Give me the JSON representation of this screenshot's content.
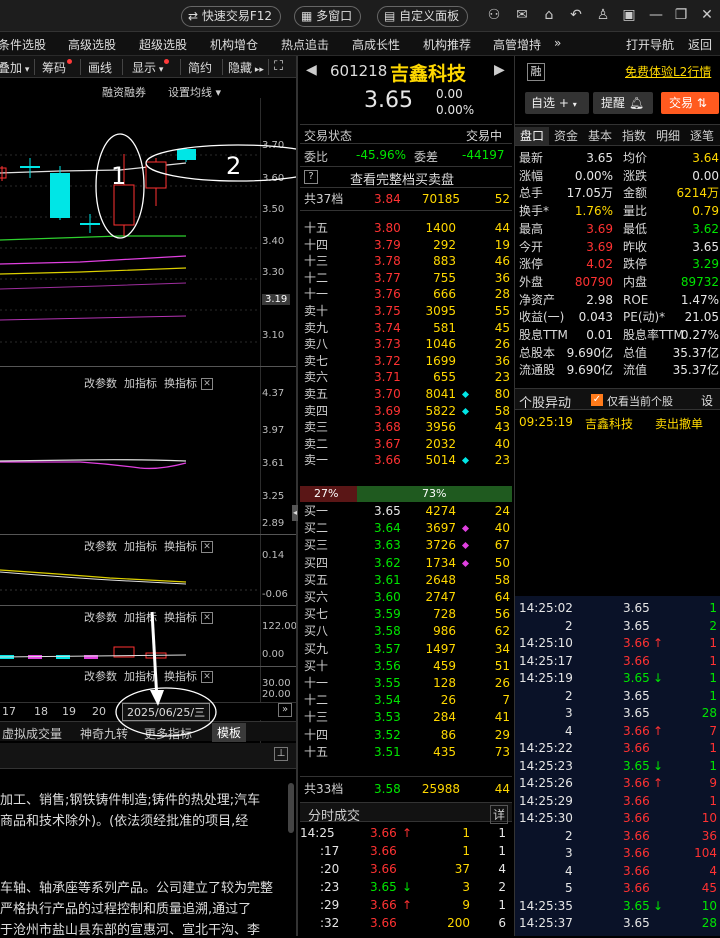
{
  "titlebar": {
    "quick_trade": "快速交易F12",
    "multi_window": "多窗口",
    "custom_panel": "自定义面板"
  },
  "menu": [
    "条件选股",
    "高级选股",
    "超级选股",
    "机构增仓",
    "热点追击",
    "高成长性",
    "机构推荐",
    "高管增持"
  ],
  "menu_more": "»",
  "menu_right": [
    "打开导航",
    "返回"
  ],
  "toolbar": [
    "叠加",
    "筹码",
    "画线",
    "显示",
    "简约",
    "隐藏"
  ],
  "chart": {
    "sub_label_left": "融资融券",
    "sub_label_right": "设置均线",
    "main_axis": [
      "3.70",
      "3.60",
      "3.50",
      "3.40",
      "3.30",
      "3.19",
      "3.10"
    ],
    "macd_axis": [
      "4.37",
      "3.97",
      "3.61",
      "3.25",
      "2.89"
    ],
    "ind2_axis": [
      "0.14",
      "-0.06"
    ],
    "ind3_axis": [
      "122.00",
      "0.00"
    ],
    "ind4_axis": [
      "30.00",
      "20.00"
    ],
    "panel_buttons": [
      "改参数",
      "加指标",
      "换指标"
    ],
    "xticks": [
      "17",
      "18",
      "19",
      "20"
    ],
    "date_box": "2025/06/25/三",
    "bottom_tabs": [
      "虚拟成交量",
      "神奇九转",
      "更多指标",
      "模板"
    ]
  },
  "annotations": [
    "1",
    "2"
  ],
  "company_text": [
    "加工、销售;钢铁铸件制造;铸件的热处理;汽车",
    "商品和技术除外)。(依法须经批准的项目,经",
    "车轴、轴承座等系列产品。公司建立了较为完整",
    "严格执行产品的过程控制和质量追溯,通过了",
    "于沧州市盐山县东部的宣惠河、宣北干沟、李"
  ],
  "stock": {
    "code": "601218",
    "name": "吉鑫科技",
    "price": "3.65",
    "change": "0.00",
    "pct": "0.00%",
    "tag": "融",
    "l2_link": "免费体验L2行情",
    "btn_watch": "自选",
    "btn_alert": "提醒",
    "btn_trade": "交易"
  },
  "orderbook": {
    "status_label": "交易状态",
    "status_value": "交易中",
    "weibi_label": "委比",
    "weibi": "-45.96%",
    "weicha_label": "委差",
    "weicha": "-44197",
    "full_link": "查看完整档买卖盘",
    "q": "?",
    "sell_total": {
      "label": "共37档",
      "price": "3.84",
      "vol": "70185",
      "n": "52"
    },
    "sells": [
      [
        "十五",
        "3.80",
        "1400",
        "44",
        ""
      ],
      [
        "十四",
        "3.79",
        "292",
        "19",
        ""
      ],
      [
        "十三",
        "3.78",
        "883",
        "46",
        ""
      ],
      [
        "十二",
        "3.77",
        "755",
        "36",
        ""
      ],
      [
        "十一",
        "3.76",
        "666",
        "28",
        ""
      ],
      [
        "卖十",
        "3.75",
        "3095",
        "55",
        ""
      ],
      [
        "卖九",
        "3.74",
        "581",
        "45",
        ""
      ],
      [
        "卖八",
        "3.73",
        "1046",
        "26",
        ""
      ],
      [
        "卖七",
        "3.72",
        "1699",
        "36",
        ""
      ],
      [
        "卖六",
        "3.71",
        "655",
        "23",
        ""
      ],
      [
        "卖五",
        "3.70",
        "8041",
        "80",
        "c"
      ],
      [
        "卖四",
        "3.69",
        "5822",
        "58",
        "c"
      ],
      [
        "卖三",
        "3.68",
        "3956",
        "43",
        ""
      ],
      [
        "卖二",
        "3.67",
        "2032",
        "40",
        ""
      ],
      [
        "卖一",
        "3.66",
        "5014",
        "23",
        "c"
      ]
    ],
    "ratio_left": "27%",
    "ratio_right": "73%",
    "ratio_frac": 0.27,
    "buys": [
      [
        "买一",
        "3.65",
        "4274",
        "24",
        "g"
      ],
      [
        "买二",
        "3.64",
        "3697",
        "40",
        "m"
      ],
      [
        "买三",
        "3.63",
        "3726",
        "67",
        "m"
      ],
      [
        "买四",
        "3.62",
        "1734",
        "50",
        "m"
      ],
      [
        "买五",
        "3.61",
        "2648",
        "58",
        "g"
      ],
      [
        "买六",
        "3.60",
        "2747",
        "64",
        "g"
      ],
      [
        "买七",
        "3.59",
        "728",
        "56",
        "g"
      ],
      [
        "买八",
        "3.58",
        "986",
        "62",
        "g"
      ],
      [
        "买九",
        "3.57",
        "1497",
        "34",
        "g"
      ],
      [
        "买十",
        "3.56",
        "459",
        "51",
        "g"
      ],
      [
        "十一",
        "3.55",
        "128",
        "26",
        "g"
      ],
      [
        "十二",
        "3.54",
        "26",
        "7",
        "g"
      ],
      [
        "十三",
        "3.53",
        "284",
        "41",
        "g"
      ],
      [
        "十四",
        "3.52",
        "86",
        "29",
        "g"
      ],
      [
        "十五",
        "3.51",
        "435",
        "73",
        "g"
      ]
    ],
    "buy_total": {
      "label": "共33档",
      "price": "3.58",
      "vol": "25988",
      "n": "44"
    }
  },
  "ticks": {
    "title": "分时成交",
    "detail": "详",
    "rows": [
      [
        "14:25",
        "3.66",
        "↑",
        "1",
        "1",
        "r"
      ],
      [
        ":17",
        "3.66",
        "",
        "1",
        "1",
        "r"
      ],
      [
        ":20",
        "3.66",
        "",
        "37",
        "4",
        "r"
      ],
      [
        ":23",
        "3.65",
        "↓",
        "3",
        "2",
        "g"
      ],
      [
        ":29",
        "3.66",
        "↑",
        "9",
        "1",
        "r"
      ],
      [
        ":32",
        "3.66",
        "",
        "200",
        "6",
        "r"
      ]
    ]
  },
  "stats": {
    "tabs": [
      "盘口",
      "资金",
      "基本",
      "指数",
      "明细",
      "逐笔"
    ],
    "rows": [
      [
        "最新",
        "3.65",
        "w",
        "均价",
        "3.64",
        "y"
      ],
      [
        "涨幅",
        "0.00%",
        "w",
        "涨跌",
        "0.00",
        "w"
      ],
      [
        "总手",
        "17.05万",
        "w",
        "金额",
        "6214万",
        "y"
      ],
      [
        "换手*",
        "1.76%",
        "y",
        "量比",
        "0.79",
        "y"
      ],
      [
        "最高",
        "3.69",
        "r",
        "最低",
        "3.62",
        "g"
      ],
      [
        "今开",
        "3.69",
        "r",
        "昨收",
        "3.65",
        "w"
      ],
      [
        "涨停",
        "4.02",
        "r",
        "跌停",
        "3.29",
        "g"
      ],
      [
        "外盘",
        "80790",
        "r",
        "内盘",
        "89732",
        "g"
      ],
      [
        "净资产",
        "2.98",
        "w",
        "ROE",
        "1.47%",
        "w"
      ],
      [
        "收益(一)",
        "0.043",
        "w",
        "PE(动)*",
        "21.05",
        "w"
      ],
      [
        "股息TTM",
        "0.01",
        "w",
        "股息率TTM",
        "0.27%",
        "w"
      ],
      [
        "总股本",
        "9.690亿",
        "w",
        "总值",
        "35.37亿",
        "w"
      ],
      [
        "流通股",
        "9.690亿",
        "w",
        "流值",
        "35.37亿",
        "w"
      ]
    ]
  },
  "movement": {
    "title": "个股异动",
    "checkbox_label": "仅看当前个股",
    "settings": "设",
    "row": {
      "time": "09:25:19",
      "name": "吉鑫科技",
      "event": "卖出撤单"
    }
  },
  "right_ticks": [
    [
      "14:25:02",
      "3.65",
      "",
      "w",
      "1",
      "g"
    ],
    [
      "2",
      "3.65",
      "",
      "w",
      "2",
      "g"
    ],
    [
      "14:25:10",
      "3.66",
      "↑",
      "r",
      "1",
      "r"
    ],
    [
      "14:25:17",
      "3.66",
      "",
      "r",
      "1",
      "r"
    ],
    [
      "14:25:19",
      "3.65",
      "↓",
      "g",
      "1",
      "g"
    ],
    [
      "2",
      "3.65",
      "",
      "w",
      "1",
      "g"
    ],
    [
      "3",
      "3.65",
      "",
      "w",
      "28",
      "g"
    ],
    [
      "4",
      "3.66",
      "↑",
      "r",
      "7",
      "r"
    ],
    [
      "14:25:22",
      "3.66",
      "",
      "r",
      "1",
      "r"
    ],
    [
      "14:25:23",
      "3.65",
      "↓",
      "g",
      "1",
      "g"
    ],
    [
      "14:25:26",
      "3.66",
      "↑",
      "r",
      "9",
      "r"
    ],
    [
      "14:25:29",
      "3.66",
      "",
      "r",
      "1",
      "r"
    ],
    [
      "14:25:30",
      "3.66",
      "",
      "r",
      "10",
      "r"
    ],
    [
      "2",
      "3.66",
      "",
      "r",
      "36",
      "r"
    ],
    [
      "3",
      "3.66",
      "",
      "r",
      "104",
      "r"
    ],
    [
      "4",
      "3.66",
      "",
      "r",
      "4",
      "r"
    ],
    [
      "5",
      "3.66",
      "",
      "r",
      "45",
      "r"
    ],
    [
      "14:25:35",
      "3.65",
      "↓",
      "g",
      "10",
      "g"
    ],
    [
      "14:25:37",
      "3.65",
      "",
      "w",
      "28",
      "g"
    ]
  ]
}
